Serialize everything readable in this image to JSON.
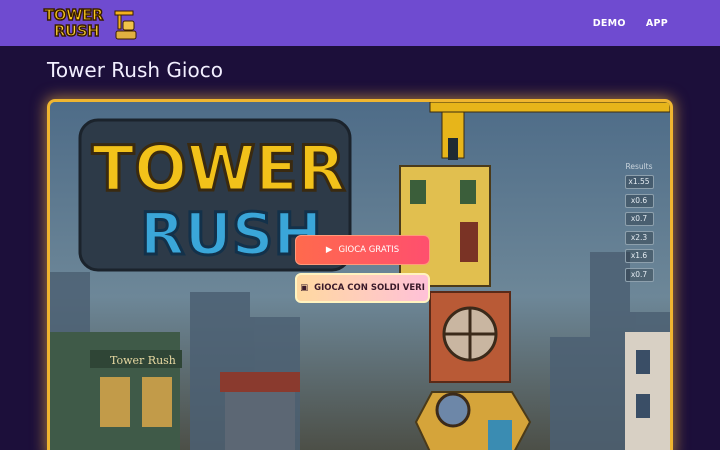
{
  "header": {
    "logo": {
      "line1": "TOWER",
      "line2": "RUSH"
    },
    "nav": [
      {
        "label": "DEMO"
      },
      {
        "label": "APP"
      }
    ]
  },
  "page": {
    "title": "Tower Rush Gioco"
  },
  "game": {
    "splash_title": {
      "line1": "TOWER",
      "line2": "RUSH"
    },
    "shop_sign": "Tower Rush",
    "buttons": {
      "free": {
        "icon": "play-icon",
        "label": "GIOCA GRATIS"
      },
      "real": {
        "icon": "money-icon",
        "label": "GIOCA CON SOLDI VERI"
      }
    },
    "results": {
      "label": "Results",
      "items": [
        "x1.55",
        "x0.6",
        "x0.7",
        "x2.3",
        "x1.6",
        "x0.7"
      ]
    }
  },
  "colors": {
    "header_bg": "#6f4bd0",
    "page_bg": "#1c0f3a",
    "frame_border": "#f0b630",
    "btn_free": "#ff5c5c",
    "btn_real": "#ffd0b8"
  }
}
